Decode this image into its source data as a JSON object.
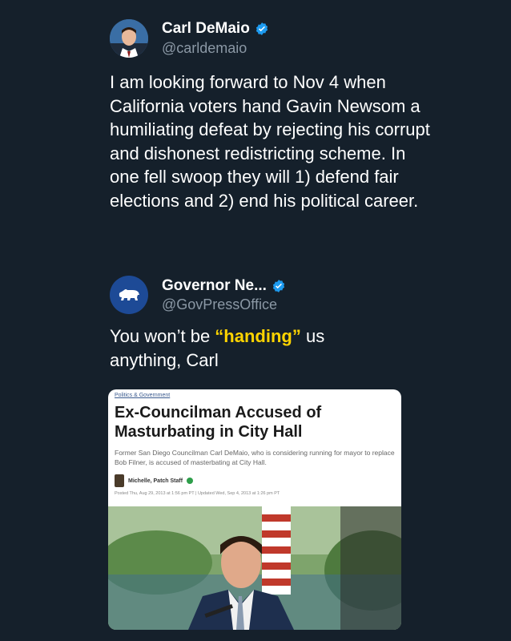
{
  "tweet1": {
    "name": "Carl DeMaio",
    "handle": "@carldemaio",
    "text": "I am looking forward to Nov 4 when California voters hand Gavin Newsom a humiliating defeat by rejecting his corrupt and dishonest redistricting scheme.  In one fell swoop they will 1) defend fair elections and 2) end his political career."
  },
  "tweet2": {
    "name": "Governor Ne...",
    "handle": "@GovPressOffice",
    "text_before": "You won’t be ",
    "text_highlight": "“handing”",
    "text_after": " us anything, Carl"
  },
  "card": {
    "category": "Politics & Government",
    "headline": "Ex-Councilman Accused of Masturbating in City Hall",
    "dek": "Former San Diego Councilman Carl DeMaio, who is considering running for mayor to replace Bob Filner, is accused of masterbating at City Hall.",
    "author": "Michelle, Patch Staff",
    "posted": "Posted Thu, Aug 29, 2013 at 1:56 pm PT  |  Updated Wed, Sep 4, 2013 at 1:26 pm PT"
  },
  "colors": {
    "background": "#15202b",
    "verified": "#1d9bf0",
    "highlight": "#ffd400",
    "handle": "#8b98a5"
  }
}
